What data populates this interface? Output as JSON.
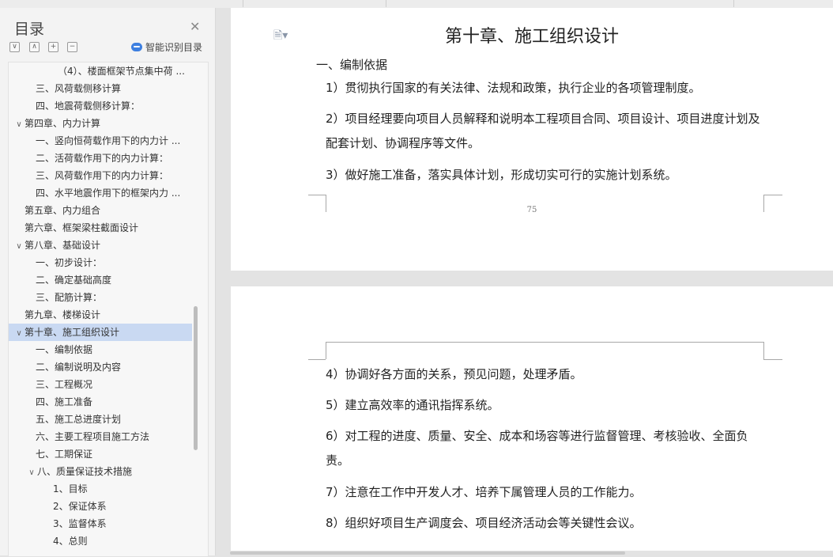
{
  "sidebar": {
    "title": "目录",
    "smart_toc_label": "智能识别目录",
    "items": [
      {
        "label": "（4）、楼面框架节点集中荷 ...",
        "level": 3,
        "caret": ""
      },
      {
        "label": "三、风荷载侧移计算",
        "level": 1,
        "caret": ""
      },
      {
        "label": "四、地震荷载侧移计算：",
        "level": 1,
        "caret": ""
      },
      {
        "label": "第四章、内力计算",
        "level": 0,
        "caret": "∨"
      },
      {
        "label": "一、竖向恒荷载作用下的内力计 ...",
        "level": 1,
        "caret": ""
      },
      {
        "label": "二、活荷载作用下的内力计算：",
        "level": 1,
        "caret": ""
      },
      {
        "label": "三、风荷载作用下的内力计算：",
        "level": 1,
        "caret": ""
      },
      {
        "label": "四、水平地震作用下的框架内力 ...",
        "level": 1,
        "caret": ""
      },
      {
        "label": "第五章、内力组合",
        "level": 0,
        "caret": ""
      },
      {
        "label": "第六章、框架梁柱截面设计",
        "level": 0,
        "caret": ""
      },
      {
        "label": "第八章、基础设计",
        "level": 0,
        "caret": "∨"
      },
      {
        "label": "一、初步设计：",
        "level": 1,
        "caret": ""
      },
      {
        "label": "二、确定基础高度",
        "level": 1,
        "caret": ""
      },
      {
        "label": "三、配筋计算：",
        "level": 1,
        "caret": ""
      },
      {
        "label": "第九章、楼梯设计",
        "level": 0,
        "caret": ""
      },
      {
        "label": "第十章、施工组织设计",
        "level": 0,
        "caret": "∨",
        "selected": true
      },
      {
        "label": "一、编制依据",
        "level": 1,
        "caret": ""
      },
      {
        "label": "二、编制说明及内容",
        "level": 1,
        "caret": ""
      },
      {
        "label": "三、工程概况",
        "level": 1,
        "caret": ""
      },
      {
        "label": "四、施工准备",
        "level": 1,
        "caret": ""
      },
      {
        "label": "五、施工总进度计划",
        "level": 1,
        "caret": ""
      },
      {
        "label": "六、主要工程项目施工方法",
        "level": 1,
        "caret": ""
      },
      {
        "label": "七、工期保证",
        "level": 1,
        "caret": ""
      },
      {
        "label": "八、质量保证技术措施",
        "level": 1,
        "caret": "∨"
      },
      {
        "label": "1、目标",
        "level": 2,
        "caret": ""
      },
      {
        "label": "2、保证体系",
        "level": 2,
        "caret": ""
      },
      {
        "label": "3、监督体系",
        "level": 2,
        "caret": ""
      },
      {
        "label": "4、总则",
        "level": 2,
        "caret": ""
      }
    ]
  },
  "document": {
    "chapter_title": "第十章、施工组织设计",
    "section_heading": "一、编制依据",
    "page1_paragraphs": [
      "1）贯彻执行国家的有关法律、法规和政策，执行企业的各项管理制度。",
      "2）项目经理要向项目人员解释和说明本工程项目合同、项目设计、项目进度计划及配套计划、协调程序等文件。",
      "3）做好施工准备，落实具体计划，形成切实可行的实施计划系统。"
    ],
    "page_number": "75",
    "page2_paragraphs": [
      "4）协调好各方面的关系，预见问题，处理矛盾。",
      "5）建立高效率的通讯指挥系统。",
      "6）对工程的进度、质量、安全、成本和场容等进行监督管理、考核验收、全面负责。",
      "7）注意在工作中开发人才、培养下属管理人员的工作能力。",
      "8）组织好项目生产调度会、项目经济活动会等关键性会议。"
    ]
  }
}
